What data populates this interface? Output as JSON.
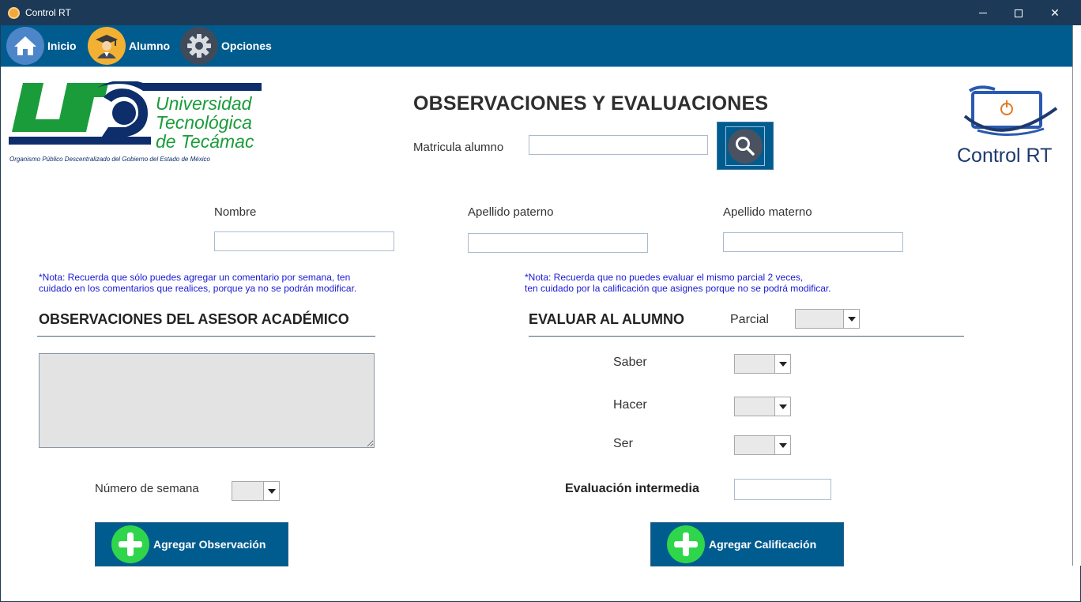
{
  "window": {
    "title": "Control RT"
  },
  "toolbar": {
    "items": [
      {
        "label": "Inicio",
        "icon": "home-icon"
      },
      {
        "label": "Alumno",
        "icon": "student-icon"
      },
      {
        "label": "Opciones",
        "icon": "gear-icon"
      }
    ]
  },
  "logos": {
    "university_line1": "Universidad",
    "university_line2": "Tecnológica",
    "university_line3": "de Tecámac",
    "university_tagline": "Organismo Público Descentralizado del Gobierno del Estado de México",
    "app_name": "Control RT"
  },
  "header": {
    "title": "OBSERVACIONES Y EVALUACIONES",
    "matricula_label": "Matricula alumno",
    "matricula_value": ""
  },
  "student": {
    "nombre_label": "Nombre",
    "nombre_value": "",
    "paterno_label": "Apellido paterno",
    "paterno_value": "",
    "materno_label": "Apellido materno",
    "materno_value": ""
  },
  "notes": {
    "left_line1": "*Nota: Recuerda que sólo puedes agregar un comentario por semana, ten",
    "left_line2": "cuidado en los comentarios que realices, porque ya no se podrán modificar.",
    "right_line1": "*Nota: Recuerda que no puedes evaluar el mismo parcial 2 veces,",
    "right_line2": "ten cuidado por la calificación que asignes porque no se podrá modificar."
  },
  "observaciones": {
    "title": "OBSERVACIONES DEL ASESOR ACADÉMICO",
    "text": "",
    "semana_label": "Número de semana",
    "semana_value": "",
    "button": "Agregar Observación"
  },
  "evaluacion": {
    "title": "EVALUAR AL ALUMNO",
    "parcial_label": "Parcial",
    "parcial_value": "",
    "saber_label": "Saber",
    "saber_value": "",
    "hacer_label": "Hacer",
    "hacer_value": "",
    "ser_label": "Ser",
    "ser_value": "",
    "intermedia_label": "Evaluación intermedia",
    "intermedia_value": "",
    "button": "Agregar Calificación"
  },
  "colors": {
    "titlebar": "#1c3a57",
    "toolbar": "#005c8f",
    "note_text": "#1a1ad6",
    "ut_green": "#1a9c3a",
    "ut_navy": "#0d2d6b",
    "plus_green": "#2fd64b"
  }
}
